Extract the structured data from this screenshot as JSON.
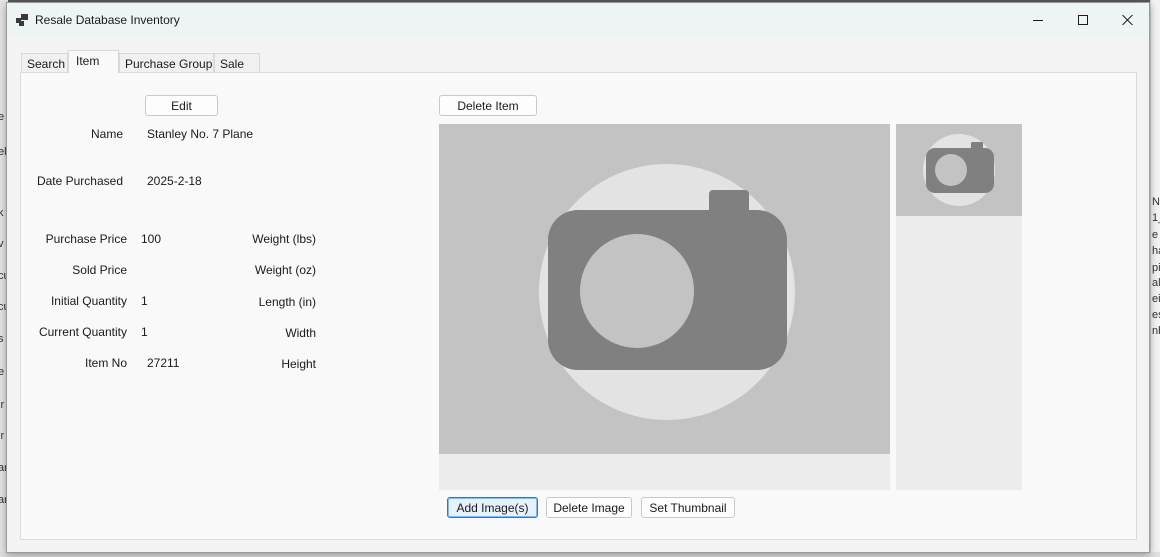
{
  "window": {
    "title": "Resale Database Inventory"
  },
  "tabs": [
    {
      "label": "Search"
    },
    {
      "label": "Item"
    },
    {
      "label": "Purchase Group"
    },
    {
      "label": "Sale"
    }
  ],
  "active_tab": "Item",
  "buttons": {
    "edit": "Edit",
    "delete_item": "Delete Item",
    "add_images": "Add Image(s)",
    "delete_image": "Delete Image",
    "set_thumbnail": "Set Thumbnail"
  },
  "fields": {
    "name": {
      "label": "Name",
      "value": "Stanley No. 7 Plane"
    },
    "date_purchased": {
      "label": "Date Purchased",
      "value": "2025-2-18"
    },
    "purchase_price": {
      "label": "Purchase Price",
      "value": "100"
    },
    "sold_price": {
      "label": "Sold Price",
      "value": ""
    },
    "initial_quantity": {
      "label": "Initial Quantity",
      "value": "1"
    },
    "current_quantity": {
      "label": "Current Quantity",
      "value": "1"
    },
    "item_no": {
      "label": "Item No",
      "value": "27211"
    },
    "weight_lbs": {
      "label": "Weight (lbs)",
      "value": ""
    },
    "weight_oz": {
      "label": "Weight (oz)",
      "value": ""
    },
    "length_in": {
      "label": "Length (in)",
      "value": ""
    },
    "width": {
      "label": "Width",
      "value": ""
    },
    "height": {
      "label": "Height",
      "value": ""
    }
  },
  "images": {
    "main_icon": "camera-placeholder-icon",
    "thumbnail_icon": "camera-placeholder-icon"
  },
  "background_fragments": {
    "left": [
      "e",
      "el",
      "k",
      "v",
      "cu",
      "cu",
      "s",
      "e",
      "ir",
      "ir",
      "ar",
      "ar"
    ],
    "right": [
      "Na",
      "1_",
      "e",
      "ha",
      "pi",
      "alc",
      "ei",
      "es",
      "nb"
    ]
  },
  "colors": {
    "image_bg": "#c3c3c3",
    "placeholder_circle": "#e3e3e3",
    "camera": "#808080",
    "primary_button_border": "#2f78c8"
  }
}
